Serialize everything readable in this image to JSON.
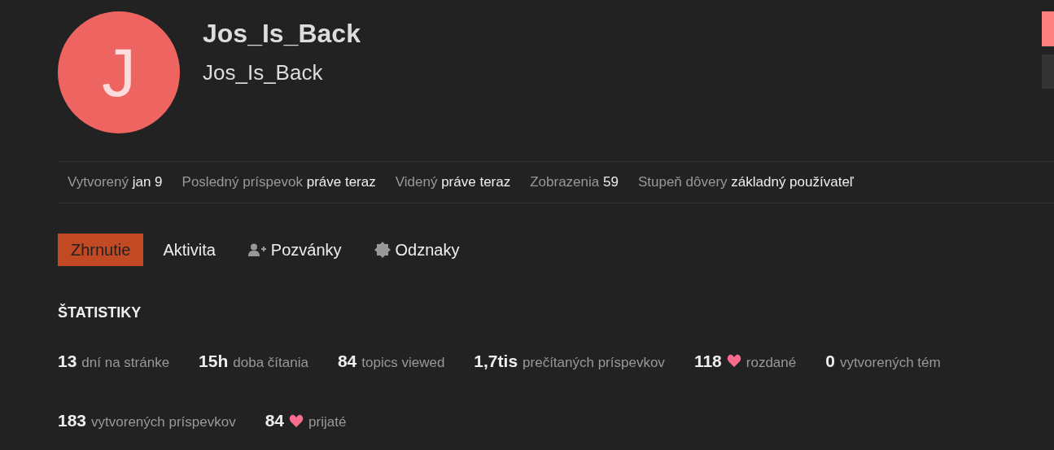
{
  "user": {
    "avatar_letter": "J",
    "username": "Jos_Is_Back",
    "name": "Jos_Is_Back"
  },
  "meta": [
    {
      "label": "Vytvorený",
      "value": "jan 9"
    },
    {
      "label": "Posledný príspevok",
      "value": "práve teraz"
    },
    {
      "label": "Videný",
      "value": "práve teraz"
    },
    {
      "label": "Zobrazenia",
      "value": "59"
    },
    {
      "label": "Stupeň dôvery",
      "value": "základný používateľ"
    }
  ],
  "tabs": [
    {
      "label": "Zhrnutie",
      "selected": true,
      "kind": "plain"
    },
    {
      "label": "Aktivita",
      "selected": false,
      "kind": "plain"
    },
    {
      "label": "Pozvánky",
      "selected": false,
      "kind": "user-plus"
    },
    {
      "label": "Odznaky",
      "selected": false,
      "kind": "badge"
    }
  ],
  "stats_heading": "ŠTATISTIKY",
  "stats": [
    {
      "value": "13",
      "label": "dní na stránke",
      "kind": "plain"
    },
    {
      "value": "15h",
      "label": "doba čítania",
      "kind": "plain"
    },
    {
      "value": "84",
      "label": "topics viewed",
      "kind": "plain"
    },
    {
      "value": "1,7tis",
      "label": "prečítaných príspevkov",
      "kind": "plain"
    },
    {
      "value": "118",
      "label": "rozdané",
      "kind": "heart"
    },
    {
      "value": "0",
      "label": "vytvorených tém",
      "kind": "plain"
    },
    {
      "value": "183",
      "label": "vytvorených príspevkov",
      "kind": "plain"
    },
    {
      "value": "84",
      "label": "prijaté",
      "kind": "heart"
    }
  ]
}
